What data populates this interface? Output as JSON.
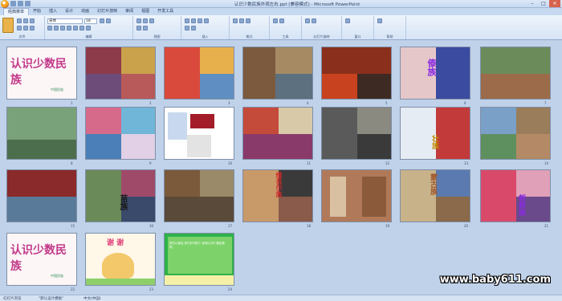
{
  "window": {
    "title": "认识少数民族外观左右.ppt [兼容模式] - Microsoft PowerPoint",
    "min": "–",
    "max": "□",
    "close": "✕"
  },
  "ribbon_tabs": [
    "经典菜单",
    "开始",
    "插入",
    "设计",
    "动画",
    "幻灯片放映",
    "审阅",
    "视图",
    "开发工具"
  ],
  "ribbon_groups": [
    "文件",
    "编辑",
    "视图",
    "插入",
    "格式",
    "工具",
    "幻灯片放映",
    "窗口",
    "帮助"
  ],
  "font": {
    "name": "宋体",
    "size": "18"
  },
  "slides": [
    {
      "n": "1",
      "title": "认识少数民族",
      "sub": "中国民族"
    },
    {
      "n": "2"
    },
    {
      "n": "3"
    },
    {
      "n": "4"
    },
    {
      "n": "5"
    },
    {
      "n": "6",
      "label": "傣族"
    },
    {
      "n": "7"
    },
    {
      "n": "8"
    },
    {
      "n": "9"
    },
    {
      "n": "10"
    },
    {
      "n": "11"
    },
    {
      "n": "12"
    },
    {
      "n": "13",
      "label": "壮族"
    },
    {
      "n": "14"
    },
    {
      "n": "15"
    },
    {
      "n": "16",
      "label": "苗族"
    },
    {
      "n": "17"
    },
    {
      "n": "18",
      "label": "维吾尔族"
    },
    {
      "n": "19"
    },
    {
      "n": "20",
      "label": "蒙古族"
    },
    {
      "n": "21",
      "label": "朝鲜族"
    },
    {
      "n": "22",
      "title": "认识少数民族",
      "sub": "中国民族"
    },
    {
      "n": "23",
      "title": "谢 谢"
    },
    {
      "n": "24",
      "text": "各位小朋友,你们好!我们一起来认识少数民族吧。"
    }
  ],
  "status": {
    "left": "幻灯片浏览",
    "theme": "\"默认设计模板\"",
    "lang": "中文(中国)"
  },
  "watermark": "www.baby611.com",
  "colors": {
    "ribbon_bg": "#d6e4f5",
    "workspace": "#bfd2ea",
    "title_red": "#d2282a",
    "title_purple": "#8a2be2"
  }
}
